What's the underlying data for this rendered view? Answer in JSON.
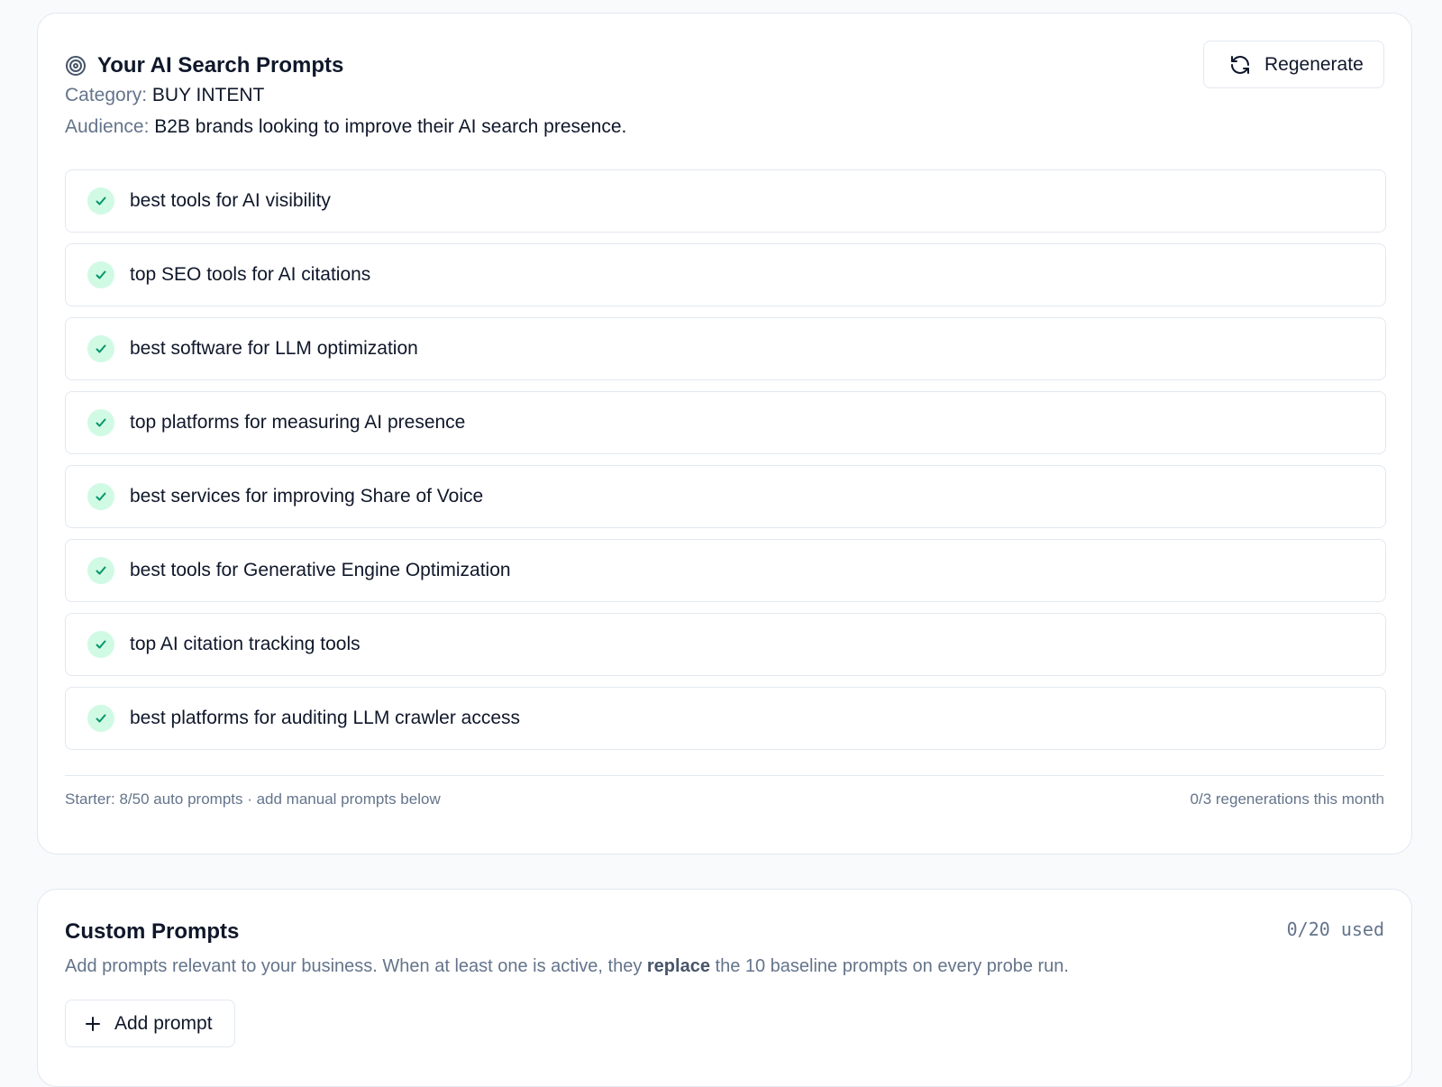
{
  "ai_prompts": {
    "title": "Your AI Search Prompts",
    "title_icon": "target-icon",
    "regenerate_label": "Regenerate",
    "regenerate_icon": "refresh-icon",
    "category_key": "Category:",
    "category_value": "BUY INTENT",
    "audience_key": "Audience:",
    "audience_value": "B2B brands looking to improve their AI search presence.",
    "check_icon": "check-icon",
    "prompts": [
      "best tools for AI visibility",
      "top SEO tools for AI citations",
      "best software for LLM optimization",
      "top platforms for measuring AI presence",
      "best services for improving Share of Voice",
      "best tools for Generative Engine Optimization",
      "top AI citation tracking tools",
      "best platforms for auditing LLM crawler access"
    ],
    "footer_left": "Starter: 8/50 auto prompts · add manual prompts below",
    "footer_right": "0/3 regenerations this month"
  },
  "custom_prompts": {
    "title": "Custom Prompts",
    "usage": "0/20 used",
    "description_before": "Add prompts relevant to your business. When at least one is active, they ",
    "description_bold": "replace",
    "description_after": " the 10 baseline prompts on every probe run.",
    "add_label": "Add prompt",
    "add_icon": "plus-icon"
  },
  "colors": {
    "page_bg": "#f8fafc",
    "card_bg": "#ffffff",
    "border": "#e2e8f0",
    "text_primary": "#0f172a",
    "text_muted": "#64748b",
    "check_bg": "#d1fae5",
    "check_stroke": "#059669"
  }
}
